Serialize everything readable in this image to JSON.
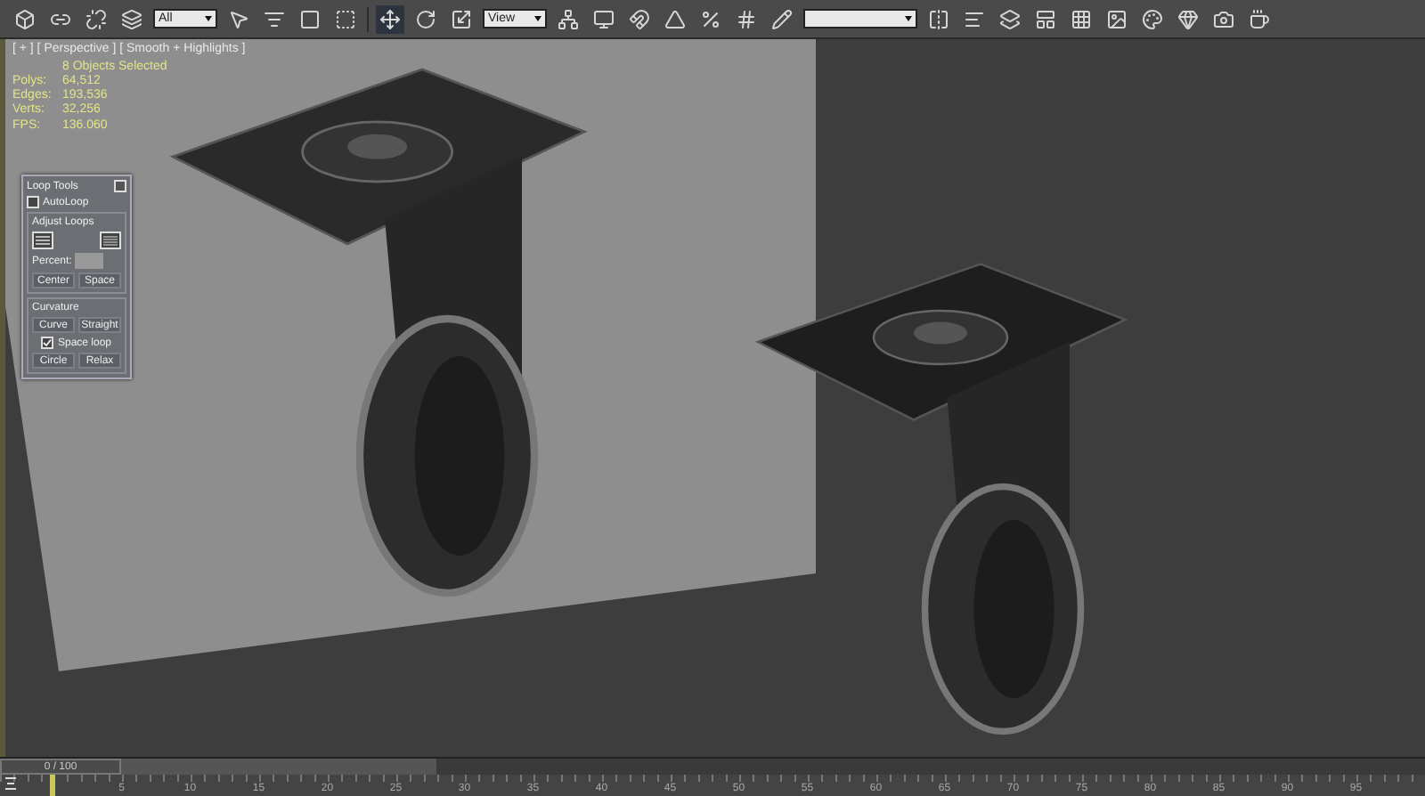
{
  "toolbar": {
    "selection_filter": "All",
    "reference_coordinate": "View"
  },
  "viewport": {
    "label": "[ + ] [ Perspective ] [ Smooth + Highlights ]",
    "selection_summary": "8 Objects Selected",
    "stats": [
      {
        "name": "Polys:",
        "value": "64,512"
      },
      {
        "name": "Edges:",
        "value": "193,536"
      },
      {
        "name": "Verts:",
        "value": "32,256"
      }
    ],
    "fps": {
      "name": "FPS:",
      "value": "136.060"
    }
  },
  "loop_tools": {
    "title": "Loop Tools",
    "autoloop": {
      "label": "AutoLoop",
      "checked": false
    },
    "adjust_group": "Adjust Loops",
    "percent_label": "Percent:",
    "adjust_buttons": [
      "Center",
      "Space"
    ],
    "curvature_group": "Curvature",
    "curvature_buttons": [
      "Curve",
      "Straight"
    ],
    "space_loop": {
      "label": "Space loop",
      "checked": true
    },
    "bottom_buttons": [
      "Circle",
      "Relax"
    ]
  },
  "time_slider": {
    "label": "0 / 100",
    "level": 0
  },
  "ruler": {
    "labels": [
      "5",
      "10",
      "15",
      "20",
      "25",
      "30",
      "35",
      "40",
      "45",
      "50",
      "55",
      "60",
      "65",
      "70",
      "75",
      "80",
      "85",
      "90",
      "95"
    ]
  }
}
